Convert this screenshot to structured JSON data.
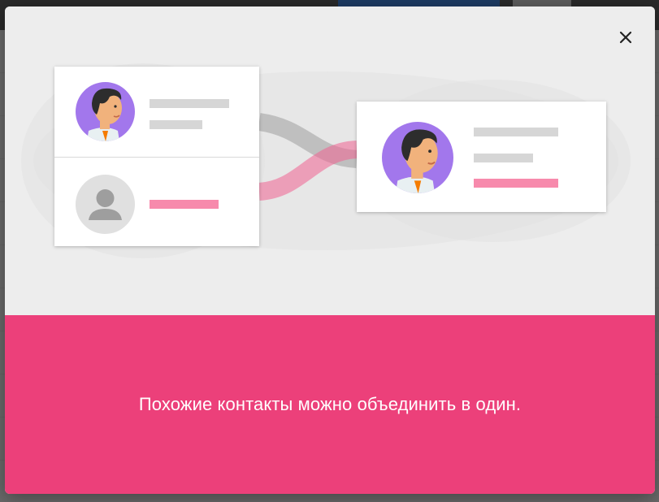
{
  "dialog": {
    "message": "Похожие контакты можно объединить в один."
  },
  "icons": {
    "close": "close-icon",
    "person_placeholder": "person-icon",
    "avatar": "avatar-illustration"
  },
  "colors": {
    "banner": "#ec407a",
    "avatar_bg": "#a277ec",
    "accent_bar": "#f78aac",
    "line_bar": "#d6d6d6",
    "merge_stream_pink": "#f06292",
    "merge_stream_gray": "#9e9e9e"
  }
}
